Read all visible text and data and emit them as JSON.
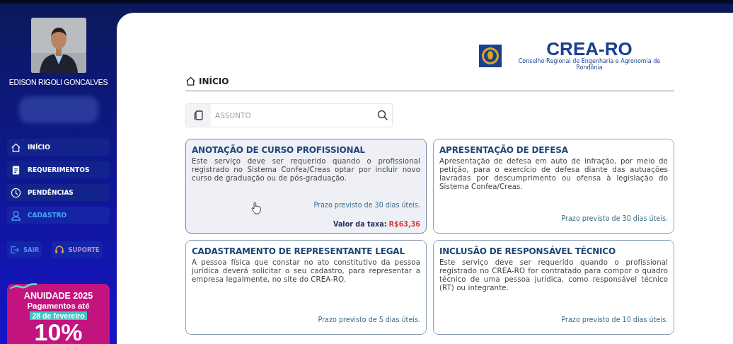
{
  "sidebar": {
    "user": {
      "name": "EDISON RIGOLI GONCALVES"
    },
    "nav": [
      {
        "label": "INÍCIO",
        "kind": "home",
        "selected": false
      },
      {
        "label": "REQUERIMENTOS",
        "kind": "document",
        "selected": false
      },
      {
        "label": "PENDÊNCIAS",
        "kind": "clock",
        "selected": false
      },
      {
        "label": "CADASTRO",
        "kind": "user",
        "selected": true
      }
    ],
    "actions": [
      {
        "label": "SAIR",
        "kind": "logout"
      },
      {
        "label": "SUPORTE",
        "kind": "support"
      }
    ],
    "promo": {
      "title": "ANUIDADE 2025",
      "line": "Pagamentos até",
      "date": "28 de fevereiro",
      "discount": "10%"
    }
  },
  "logo": {
    "name": "CREA-RO",
    "subtitle": "Conselho Regional de Engenharia e Agronomia de Rondônia"
  },
  "page": {
    "title": "INÍCIO"
  },
  "search": {
    "placeholder": "ASSUNTO"
  },
  "cards": [
    {
      "title": "ANOTAÇÃO DE CURSO PROFISSIONAL",
      "description": "Este serviço deve ser requerido quando o profissional registrado no Sistema Confea/Creas optar por incluir novo curso de graduação ou de pós-graduação.",
      "deadline": "Prazo previsto de 30 dias úteis.",
      "fee_label": "Valor da taxa:",
      "fee": "R$63,36",
      "highlighted": true
    },
    {
      "title": "APRESENTAÇÃO DE DEFESA",
      "description": "Apresentação de defesa em auto de infração, por meio de petição, para o exercício de defesa diante das autuações lavradas por descumprimento ou ofensa à legislação do Sistema Confea/Creas.",
      "deadline": "Prazo previsto de 30 dias úteis.",
      "highlighted": false
    },
    {
      "title": "CADASTRAMENTO DE REPRESENTANTE LEGAL",
      "description": "A pessoa física que constar no ato constitutivo da pessoa jurídica deverá solicitar o seu cadastro, para representar a empresa legalmente, no site do CREA-RO.",
      "deadline": "Prazo previsto de 5 dias úteis.",
      "highlighted": false
    },
    {
      "title": "INCLUSÃO DE RESPONSÁVEL TÉCNICO",
      "description": "Este serviço deve ser requerido quando o profissional registrado no CREA-RO for contratado para compor o quadro técnico de uma pessoa jurídica, como responsável técnico (RT) ou integrante.",
      "deadline": "Prazo previsto de 10 dias úteis.",
      "highlighted": false
    }
  ]
}
